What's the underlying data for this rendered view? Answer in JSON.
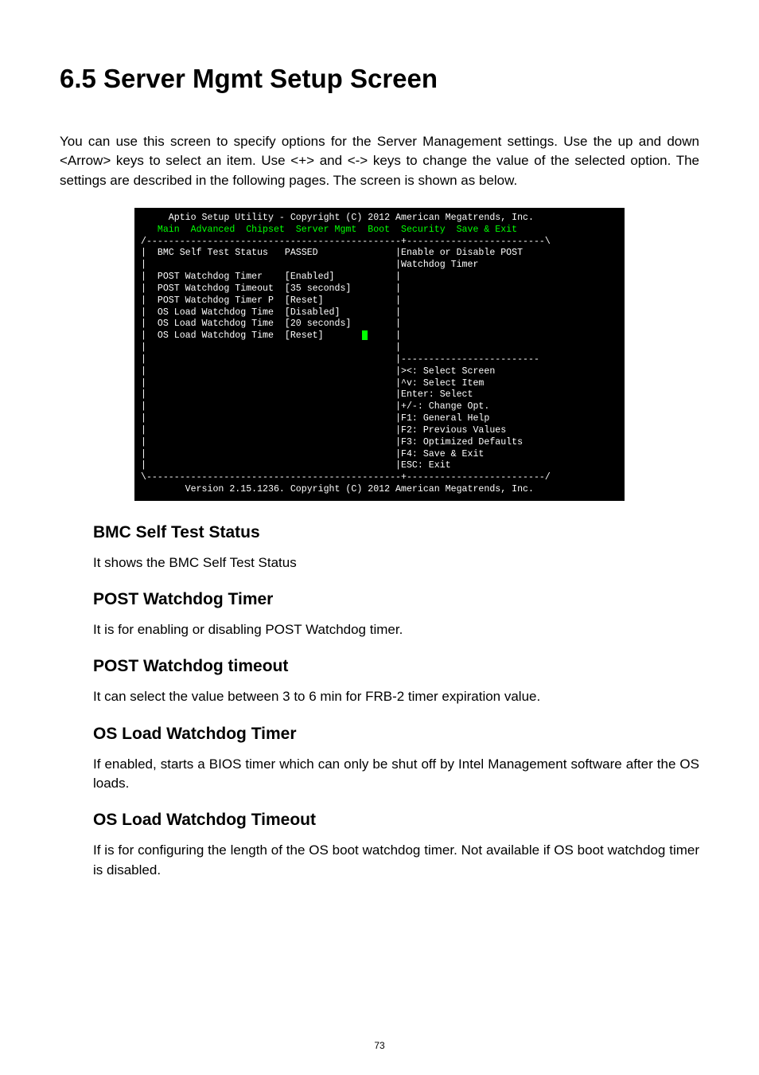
{
  "page": {
    "title": "6.5 Server Mgmt Setup Screen",
    "intro": "You can use this screen to specify options for the Server Management settings. Use the up and down <Arrow> keys to select an item. Use <+> and <-> keys to change the value of the selected option. The settings are described in the following pages. The screen is shown as below.",
    "footer_pagenum": "73"
  },
  "bios": {
    "header": "     Aptio Setup Utility - Copyright (C) 2012 American Megatrends, Inc.",
    "menu": "   Main  Advanced  Chipset  Server Mgmt  Boot  Security  Save & Exit",
    "top_sep": "/----------------------------------------------+-------------------------\\",
    "rows": [
      {
        "label": "BMC Self Test Status",
        "value": "PASSED",
        "help": "Enable or Disable POST"
      },
      {
        "label": "",
        "value": "",
        "help": "Watchdog Timer"
      },
      {
        "label": "POST Watchdog Timer",
        "value": "[Enabled]",
        "help": ""
      },
      {
        "label": "POST Watchdog Timeout",
        "value": "[35 seconds]",
        "help": ""
      },
      {
        "label": "POST Watchdog Timer P",
        "value": "[Reset]",
        "help": ""
      },
      {
        "label": "OS Load Watchdog Time",
        "value": "[Disabled]",
        "help": ""
      },
      {
        "label": "OS Load Watchdog Time",
        "value": "[20 seconds]",
        "help": ""
      },
      {
        "label": "OS Load Watchdog Time",
        "value": "[Reset]",
        "help": "",
        "cursor": true
      },
      {
        "label": "",
        "value": "",
        "help": ""
      },
      {
        "label": "",
        "value": "",
        "help": "-------------------------"
      },
      {
        "label": "",
        "value": "",
        "help": "><: Select Screen"
      },
      {
        "label": "",
        "value": "",
        "help": "^v: Select Item"
      },
      {
        "label": "",
        "value": "",
        "help": "Enter: Select"
      },
      {
        "label": "",
        "value": "",
        "help": "+/-: Change Opt."
      },
      {
        "label": "",
        "value": "",
        "help": "F1: General Help"
      },
      {
        "label": "",
        "value": "",
        "help": "F2: Previous Values"
      },
      {
        "label": "",
        "value": "",
        "help": "F3: Optimized Defaults"
      },
      {
        "label": "",
        "value": "",
        "help": "F4: Save & Exit"
      },
      {
        "label": "",
        "value": "",
        "help": "ESC: Exit"
      }
    ],
    "bottom_sep": "\\----------------------------------------------+-------------------------/",
    "version": "        Version 2.15.1236. Copyright (C) 2012 American Megatrends, Inc."
  },
  "sections": [
    {
      "title": "BMC Self Test Status",
      "desc": "It shows the BMC Self Test Status"
    },
    {
      "title": "POST Watchdog Timer",
      "desc": "It is for enabling or disabling POST Watchdog timer."
    },
    {
      "title": "POST Watchdog  timeout",
      "desc": "It can select the value between 3 to 6 min for FRB-2 timer expiration value."
    },
    {
      "title": "OS Load Watchdog Timer",
      "desc": "If enabled, starts a BIOS timer which can only be shut off by Intel Management software after the OS loads."
    },
    {
      "title": "OS Load Watchdog Timeout",
      "desc": "If is for configuring the length of the OS boot watchdog timer. Not available if OS boot watchdog timer is disabled."
    }
  ]
}
